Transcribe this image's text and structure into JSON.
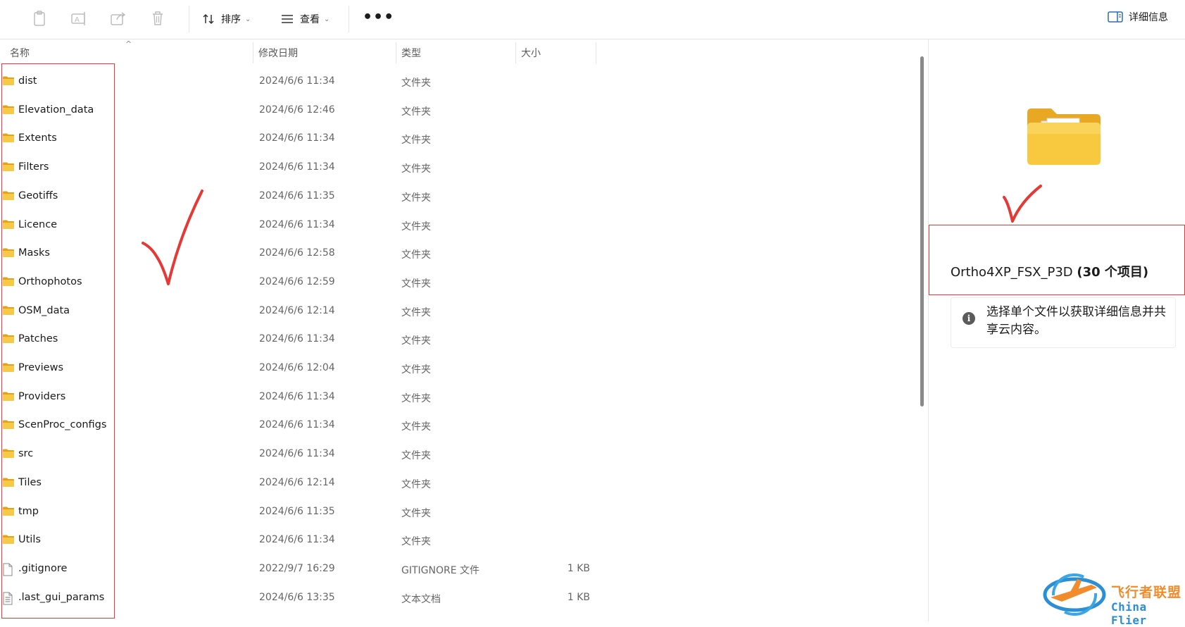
{
  "toolbar": {
    "sort_label": "排序",
    "view_label": "查看",
    "more_label": "•••",
    "details_label": "详细信息"
  },
  "columns": {
    "name": "名称",
    "date": "修改日期",
    "type": "类型",
    "size": "大小"
  },
  "files": [
    {
      "name": "dist",
      "date": "2024/6/6 11:34",
      "type": "文件夹",
      "size": "",
      "kind": "folder"
    },
    {
      "name": "Elevation_data",
      "date": "2024/6/6 12:46",
      "type": "文件夹",
      "size": "",
      "kind": "folder"
    },
    {
      "name": "Extents",
      "date": "2024/6/6 11:34",
      "type": "文件夹",
      "size": "",
      "kind": "folder"
    },
    {
      "name": "Filters",
      "date": "2024/6/6 11:34",
      "type": "文件夹",
      "size": "",
      "kind": "folder"
    },
    {
      "name": "Geotiffs",
      "date": "2024/6/6 11:35",
      "type": "文件夹",
      "size": "",
      "kind": "folder"
    },
    {
      "name": "Licence",
      "date": "2024/6/6 11:34",
      "type": "文件夹",
      "size": "",
      "kind": "folder"
    },
    {
      "name": "Masks",
      "date": "2024/6/6 12:58",
      "type": "文件夹",
      "size": "",
      "kind": "folder"
    },
    {
      "name": "Orthophotos",
      "date": "2024/6/6 12:59",
      "type": "文件夹",
      "size": "",
      "kind": "folder"
    },
    {
      "name": "OSM_data",
      "date": "2024/6/6 12:14",
      "type": "文件夹",
      "size": "",
      "kind": "folder"
    },
    {
      "name": "Patches",
      "date": "2024/6/6 11:34",
      "type": "文件夹",
      "size": "",
      "kind": "folder"
    },
    {
      "name": "Previews",
      "date": "2024/6/6 12:04",
      "type": "文件夹",
      "size": "",
      "kind": "folder"
    },
    {
      "name": "Providers",
      "date": "2024/6/6 11:34",
      "type": "文件夹",
      "size": "",
      "kind": "folder"
    },
    {
      "name": "ScenProc_configs",
      "date": "2024/6/6 11:34",
      "type": "文件夹",
      "size": "",
      "kind": "folder"
    },
    {
      "name": "src",
      "date": "2024/6/6 11:34",
      "type": "文件夹",
      "size": "",
      "kind": "folder"
    },
    {
      "name": "Tiles",
      "date": "2024/6/6 12:14",
      "type": "文件夹",
      "size": "",
      "kind": "folder"
    },
    {
      "name": "tmp",
      "date": "2024/6/6 11:35",
      "type": "文件夹",
      "size": "",
      "kind": "folder"
    },
    {
      "name": "Utils",
      "date": "2024/6/6 11:34",
      "type": "文件夹",
      "size": "",
      "kind": "folder"
    },
    {
      "name": ".gitignore",
      "date": "2022/9/7 16:29",
      "type": "GITIGNORE 文件",
      "size": "1 KB",
      "kind": "file"
    },
    {
      "name": ".last_gui_params",
      "date": "2024/6/6 13:35",
      "type": "文本文档",
      "size": "1 KB",
      "kind": "text"
    }
  ],
  "details_pane": {
    "title_name": "Ortho4XP_FSX_P3D",
    "title_count": "(30 个项目)",
    "info_text": "选择单个文件以获取详细信息并共享云内容。",
    "info_icon": "i"
  },
  "watermark": {
    "text_cn": "飞行者联盟",
    "text_en": "China Flier"
  },
  "colors": {
    "annotation_red": "#e53935",
    "folder_yellow": "#f5c542"
  }
}
